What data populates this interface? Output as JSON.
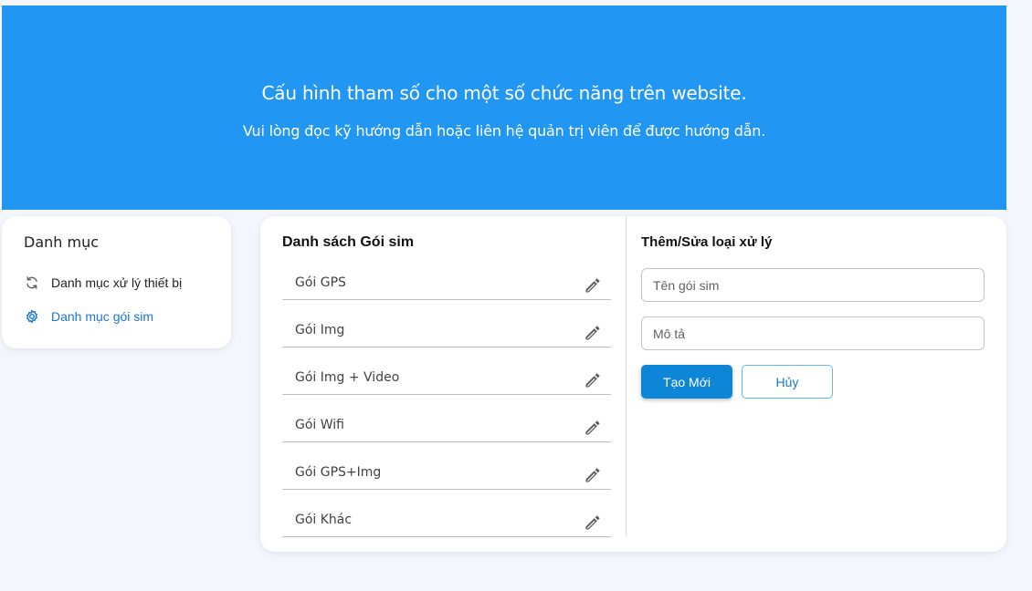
{
  "banner": {
    "title": "Cấu hình tham số cho một số chức năng trên website.",
    "subtitle": "Vui lòng đọc kỹ hướng dẫn hoặc liên hệ quản trị viên để được hướng dẫn."
  },
  "sidebar": {
    "title": "Danh mục",
    "items": [
      {
        "label": "Danh mục xử lý thiết bị",
        "icon": "sync-icon"
      },
      {
        "label": "Danh mục gói sim",
        "icon": "gear-icon",
        "active": true
      }
    ]
  },
  "list": {
    "title": "Danh sách Gói sim",
    "items": [
      {
        "label": "Gói GPS"
      },
      {
        "label": "Gói Img"
      },
      {
        "label": "Gói Img + Video"
      },
      {
        "label": "Gói Wifi"
      },
      {
        "label": "Gói GPS+Img"
      },
      {
        "label": "Gói Khác"
      }
    ]
  },
  "form": {
    "title": "Thêm/Sửa loại xử lý",
    "name_placeholder": "Tên gói sim",
    "desc_placeholder": "Mô tả",
    "create_label": "Tạo Mới",
    "cancel_label": "Hủy"
  },
  "colors": {
    "banner": "#2196f3",
    "accent": "#0d86d8",
    "link": "#1976d2"
  }
}
